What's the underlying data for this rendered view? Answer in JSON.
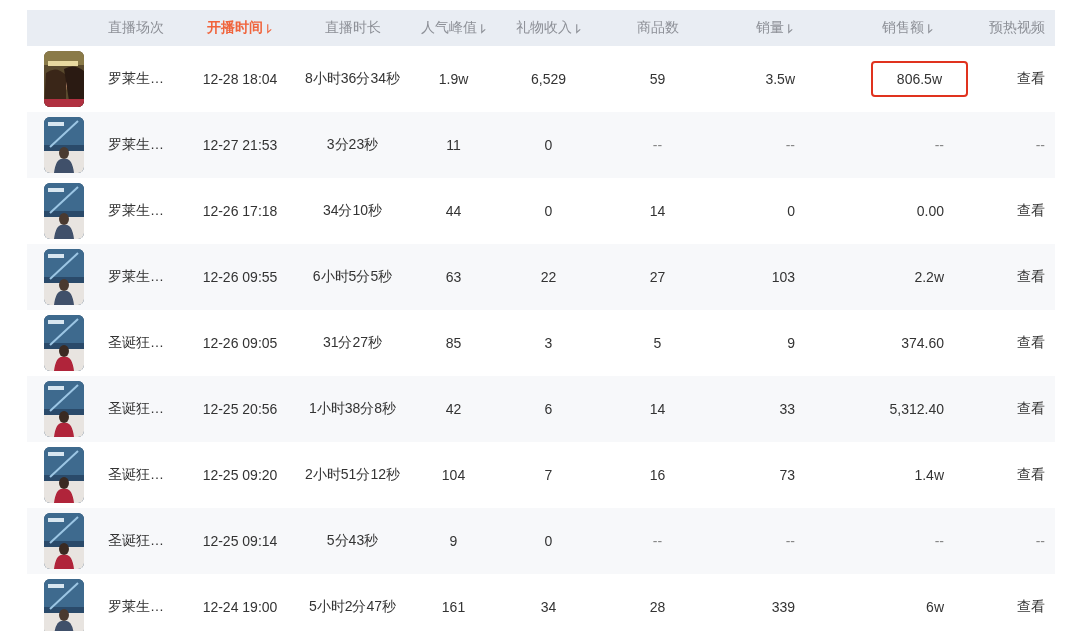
{
  "table": {
    "columns": [
      {
        "label": "直播场次",
        "sortable": false,
        "selected": false
      },
      {
        "label": "开播时间",
        "sortable": true,
        "selected": true
      },
      {
        "label": "直播时长",
        "sortable": false,
        "selected": false
      },
      {
        "label": "人气峰值",
        "sortable": true,
        "selected": false
      },
      {
        "label": "礼物收入",
        "sortable": true,
        "selected": false
      },
      {
        "label": "商品数",
        "sortable": false,
        "selected": false
      },
      {
        "label": "销量",
        "sortable": true,
        "selected": false
      },
      {
        "label": "销售额",
        "sortable": true,
        "selected": false
      },
      {
        "label": "预热视频",
        "sortable": false,
        "selected": false
      }
    ],
    "rows": [
      {
        "title": "罗莱生…",
        "start": "12-28 18:04",
        "duration": "8小时36分34秒",
        "peak": "1.9w",
        "gifts": "6,529",
        "products": "59",
        "sales": "3.5w",
        "revenue": "806.5w",
        "revenue_highlighted": true,
        "video": "查看"
      },
      {
        "title": "罗莱生…",
        "start": "12-27 21:53",
        "duration": "3分23秒",
        "peak": "11",
        "gifts": "0",
        "products": "--",
        "sales": "--",
        "revenue": "--",
        "revenue_highlighted": false,
        "video": "--"
      },
      {
        "title": "罗莱生…",
        "start": "12-26 17:18",
        "duration": "34分10秒",
        "peak": "44",
        "gifts": "0",
        "products": "14",
        "sales": "0",
        "revenue": "0.00",
        "revenue_highlighted": false,
        "video": "查看"
      },
      {
        "title": "罗莱生…",
        "start": "12-26 09:55",
        "duration": "6小时5分5秒",
        "peak": "63",
        "gifts": "22",
        "products": "27",
        "sales": "103",
        "revenue": "2.2w",
        "revenue_highlighted": false,
        "video": "查看"
      },
      {
        "title": "圣诞狂…",
        "start": "12-26 09:05",
        "duration": "31分27秒",
        "peak": "85",
        "gifts": "3",
        "products": "5",
        "sales": "9",
        "revenue": "374.60",
        "revenue_highlighted": false,
        "video": "查看"
      },
      {
        "title": "圣诞狂…",
        "start": "12-25 20:56",
        "duration": "1小时38分8秒",
        "peak": "42",
        "gifts": "6",
        "products": "14",
        "sales": "33",
        "revenue": "5,312.40",
        "revenue_highlighted": false,
        "video": "查看"
      },
      {
        "title": "圣诞狂…",
        "start": "12-25 09:20",
        "duration": "2小时51分12秒",
        "peak": "104",
        "gifts": "7",
        "products": "16",
        "sales": "73",
        "revenue": "1.4w",
        "revenue_highlighted": false,
        "video": "查看"
      },
      {
        "title": "圣诞狂…",
        "start": "12-25 09:14",
        "duration": "5分43秒",
        "peak": "9",
        "gifts": "0",
        "products": "--",
        "sales": "--",
        "revenue": "--",
        "revenue_highlighted": false,
        "video": "--"
      },
      {
        "title": "罗莱生…",
        "start": "12-24 19:00",
        "duration": "5小时2分47秒",
        "peak": "161",
        "gifts": "34",
        "products": "28",
        "sales": "339",
        "revenue": "6w",
        "revenue_highlighted": false,
        "video": "查看"
      }
    ]
  }
}
